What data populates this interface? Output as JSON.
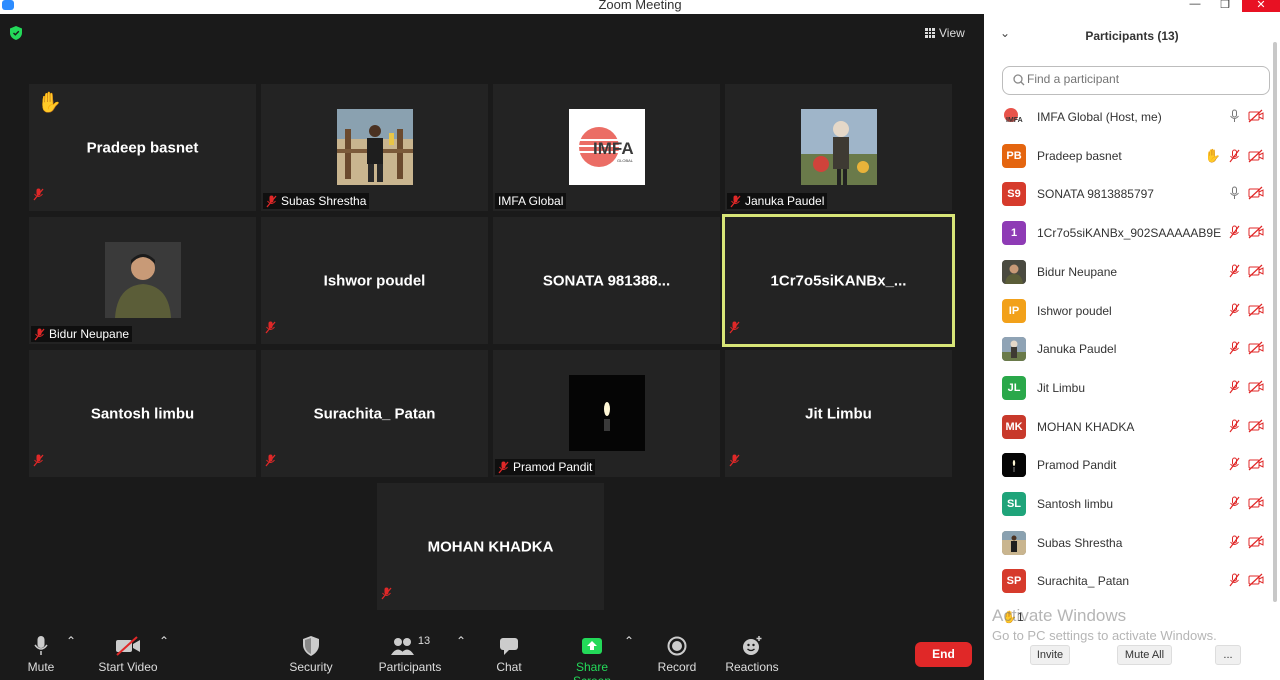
{
  "window": {
    "title": "Zoom Meeting",
    "min": "—",
    "max": "❐",
    "close": "✕"
  },
  "video": {
    "view_label": "View",
    "tiles": [
      {
        "name": "Pradeep basnet",
        "show_name": true,
        "label": "",
        "hand": true,
        "photo": false
      },
      {
        "name": "Subas Shrestha",
        "show_name": false,
        "label": "Subas Shrestha",
        "photo": true
      },
      {
        "name": "IMFA Global",
        "show_name": false,
        "label": "IMFA Global",
        "photo": true,
        "logo_text": "IMFA",
        "logo_sub": "GLOBAL"
      },
      {
        "name": "Januka Paudel",
        "show_name": false,
        "label": "Januka Paudel",
        "photo": true
      },
      {
        "name": "Bidur Neupane",
        "show_name": false,
        "label": "Bidur Neupane",
        "photo": true
      },
      {
        "name": "Ishwor poudel",
        "show_name": true,
        "label": ""
      },
      {
        "name": "SONATA  981388...",
        "show_name": true,
        "label": ""
      },
      {
        "name": "1Cr7o5siKANBx_...",
        "show_name": true,
        "label": "",
        "active": true
      },
      {
        "name": "Santosh limbu",
        "show_name": true,
        "label": ""
      },
      {
        "name": "Surachita_ Patan",
        "show_name": true,
        "label": ""
      },
      {
        "name": "Pramod Pandit",
        "show_name": false,
        "label": "Pramod Pandit",
        "photo": true
      },
      {
        "name": "Jit Limbu",
        "show_name": true,
        "label": ""
      },
      {
        "name": "MOHAN KHADKA",
        "show_name": true,
        "label": ""
      }
    ]
  },
  "toolbar": {
    "mute": "Mute",
    "start_video": "Start Video",
    "security": "Security",
    "participants": "Participants",
    "participants_count": "13",
    "chat": "Chat",
    "share_screen": "Share Screen",
    "record": "Record",
    "reactions": "Reactions",
    "end": "End",
    "share_color": "#23d959",
    "end_color": "#e02828"
  },
  "panel": {
    "title": "Participants (13)",
    "search_placeholder": "Find a participant",
    "participants": [
      {
        "name": "IMFA Global (Host, me)",
        "initials": "IMFA",
        "color": "#ffffff",
        "mic": "on",
        "hand": false
      },
      {
        "name": "Pradeep basnet",
        "initials": "PB",
        "color": "#e4650f",
        "mic": "muted",
        "hand": true
      },
      {
        "name": "SONATA 9813885797",
        "initials": "S9",
        "color": "#d63b2c",
        "mic": "on",
        "hand": false
      },
      {
        "name": "1Cr7o5siKANBx_902SAAAAAB9E...",
        "initials": "1",
        "color": "#8e3bb5",
        "mic": "muted",
        "hand": false
      },
      {
        "name": "Bidur Neupane",
        "initials": "",
        "color": "#5a5a4a",
        "mic": "muted",
        "hand": false
      },
      {
        "name": "Ishwor poudel",
        "initials": "IP",
        "color": "#f2a11a",
        "mic": "muted",
        "hand": false
      },
      {
        "name": "Januka Paudel",
        "initials": "",
        "color": "#6d6d7a",
        "mic": "muted",
        "hand": false
      },
      {
        "name": "Jit Limbu",
        "initials": "JL",
        "color": "#2aa84a",
        "mic": "muted",
        "hand": false
      },
      {
        "name": "MOHAN KHADKA",
        "initials": "MK",
        "color": "#c8392b",
        "mic": "muted",
        "hand": false
      },
      {
        "name": "Pramod Pandit",
        "initials": "",
        "color": "#111111",
        "mic": "muted",
        "hand": false
      },
      {
        "name": "Santosh limbu",
        "initials": "SL",
        "color": "#1fa47a",
        "mic": "muted",
        "hand": false
      },
      {
        "name": "Subas Shrestha",
        "initials": "",
        "color": "#6a6a5a",
        "mic": "muted",
        "hand": false
      },
      {
        "name": "Surachita_ Patan",
        "initials": "SP",
        "color": "#d63b2c",
        "mic": "muted",
        "hand": false
      }
    ],
    "invite": "Invite",
    "mute_all": "Mute All",
    "more": "...",
    "raised_hand_count": "1",
    "watermark_line1": "Activate Windows",
    "watermark_line2": "Go to PC settings to activate Windows."
  }
}
